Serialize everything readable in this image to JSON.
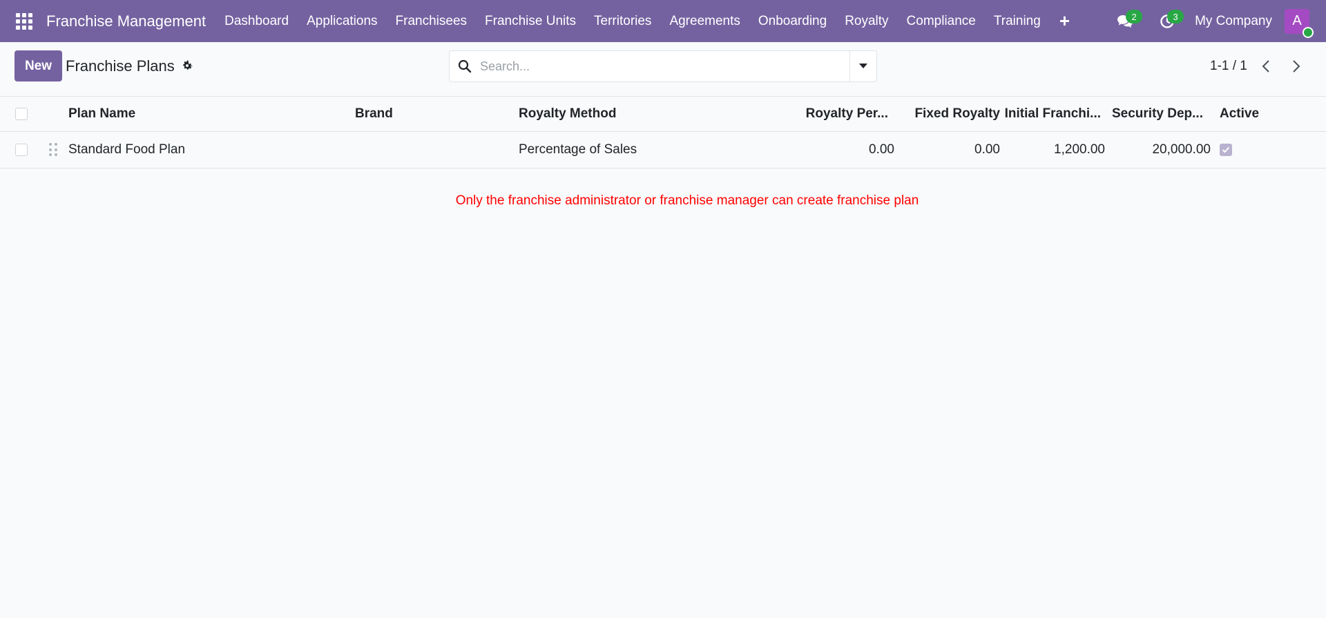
{
  "navbar": {
    "app_name": "Franchise Management",
    "menu": [
      "Dashboard",
      "Applications",
      "Franchisees",
      "Franchise Units",
      "Territories",
      "Agreements",
      "Onboarding",
      "Royalty",
      "Compliance",
      "Training"
    ],
    "plus_icon": "+",
    "messages_count": "2",
    "activities_count": "3",
    "company": "My Company",
    "avatar_initial": "A"
  },
  "control_panel": {
    "new_label": "New",
    "title": "Franchise Plans",
    "search_placeholder": "Search...",
    "pager": "1-1 / 1"
  },
  "table": {
    "headers": {
      "plan_name": "Plan Name",
      "brand": "Brand",
      "royalty_method": "Royalty Method",
      "royalty_percent": "Royalty Per...",
      "fixed_royalty": "Fixed Royalty",
      "initial_fee": "Initial Franchi...",
      "security_deposit": "Security Dep...",
      "active": "Active"
    },
    "rows": [
      {
        "plan_name": "Standard Food Plan",
        "brand": "",
        "royalty_method": "Percentage of Sales",
        "royalty_percent": "0.00",
        "fixed_royalty": "0.00",
        "initial_fee": "1,200.00",
        "security_deposit": "20,000.00",
        "active": true
      }
    ]
  },
  "message": "Only the franchise administrator or franchise manager can create franchise plan",
  "colors": {
    "brand": "#7462a0",
    "badge": "#28a745",
    "error": "#ff0000",
    "avatar": "#a44ac2"
  }
}
